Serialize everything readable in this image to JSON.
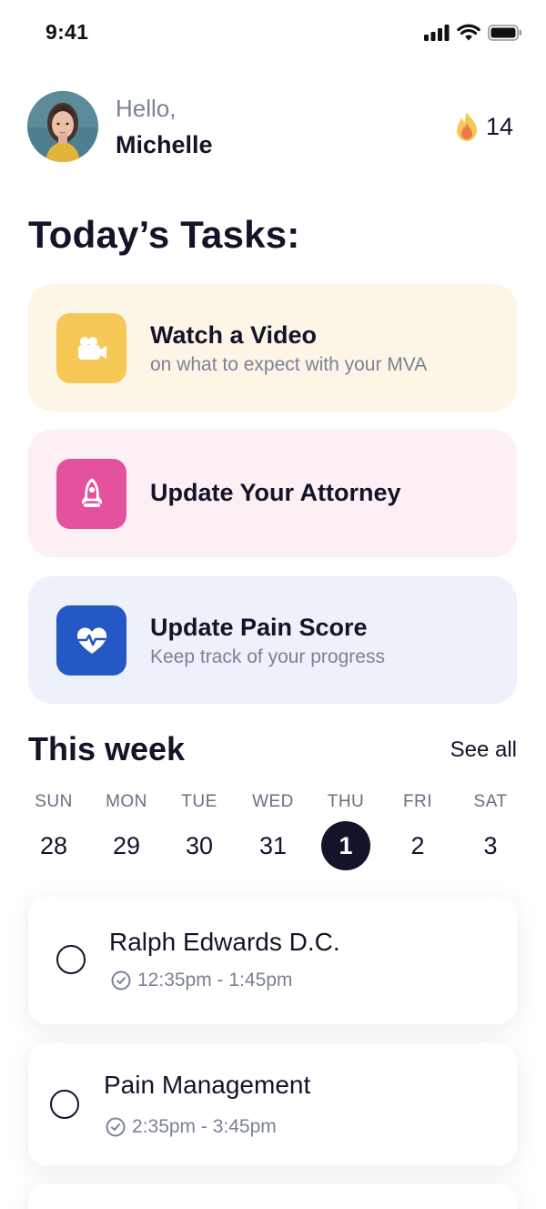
{
  "status_bar": {
    "time": "9:41",
    "icons": [
      "signal-icon",
      "wifi-icon",
      "battery-icon"
    ]
  },
  "header": {
    "greeting": "Hello,",
    "name": "Michelle",
    "streak_icon": "flame-icon",
    "streak_count": "14"
  },
  "tasks_section": {
    "title": "Today’s Tasks:",
    "tasks": [
      {
        "title": "Watch a Video",
        "subtitle": "on what to expect with your MVA",
        "icon": "video-camera-icon",
        "bg": "#fdf6e7",
        "icon_bg": "#f6c957"
      },
      {
        "title": "Update Your Attorney",
        "subtitle": "",
        "icon": "rocket-icon",
        "bg": "#fcf0f4",
        "icon_bg": "#e4519c"
      },
      {
        "title": "Update Pain Score",
        "subtitle": "Keep track of your progress",
        "icon": "heartbeat-icon",
        "bg": "#edf1f9",
        "icon_bg": "#2458c4"
      }
    ]
  },
  "week": {
    "title": "This week",
    "see_all": "See all",
    "days": [
      {
        "name": "SUN",
        "num": "28"
      },
      {
        "name": "MON",
        "num": "29"
      },
      {
        "name": "TUE",
        "num": "30"
      },
      {
        "name": "WED",
        "num": "31"
      },
      {
        "name": "THU",
        "num": "1"
      },
      {
        "name": "FRI",
        "num": "2"
      },
      {
        "name": "SAT",
        "num": "3"
      }
    ],
    "selected_day": "1"
  },
  "appointments": [
    {
      "title": "Ralph Edwards D.C.",
      "time": "12:35pm - 1:45pm",
      "icon": "clock-icon"
    },
    {
      "title": "Pain Management",
      "time": "2:35pm - 3:45pm",
      "icon": "clock-icon"
    }
  ],
  "colors": {
    "text_primary": "#13132a",
    "text_secondary": "#7b8196",
    "selected_day_bg": "#13132a"
  }
}
